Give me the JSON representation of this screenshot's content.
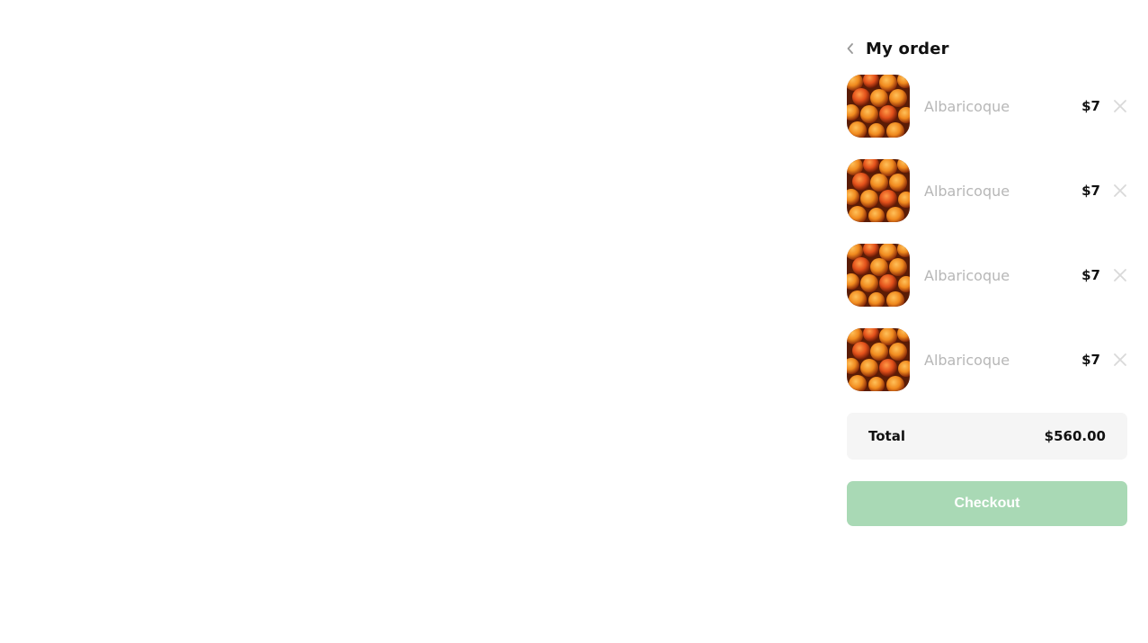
{
  "order": {
    "title": "My order",
    "back_icon": "chevron-left-icon",
    "items": [
      {
        "name": "Albaricoque",
        "price": "$7",
        "image": "apricots-image",
        "remove_icon": "close-icon"
      },
      {
        "name": "Albaricoque",
        "price": "$7",
        "image": "apricots-image",
        "remove_icon": "close-icon"
      },
      {
        "name": "Albaricoque",
        "price": "$7",
        "image": "apricots-image",
        "remove_icon": "close-icon"
      },
      {
        "name": "Albaricoque",
        "price": "$7",
        "image": "apricots-image",
        "remove_icon": "close-icon"
      }
    ],
    "total": {
      "label": "Total",
      "value": "$560.00"
    },
    "checkout_label": "Checkout"
  },
  "colors": {
    "checkout_button": "#a9d9b5",
    "total_background": "#f5f5f5",
    "item_name": "#b7b7b7",
    "remove_icon": "#d9d9d9"
  }
}
